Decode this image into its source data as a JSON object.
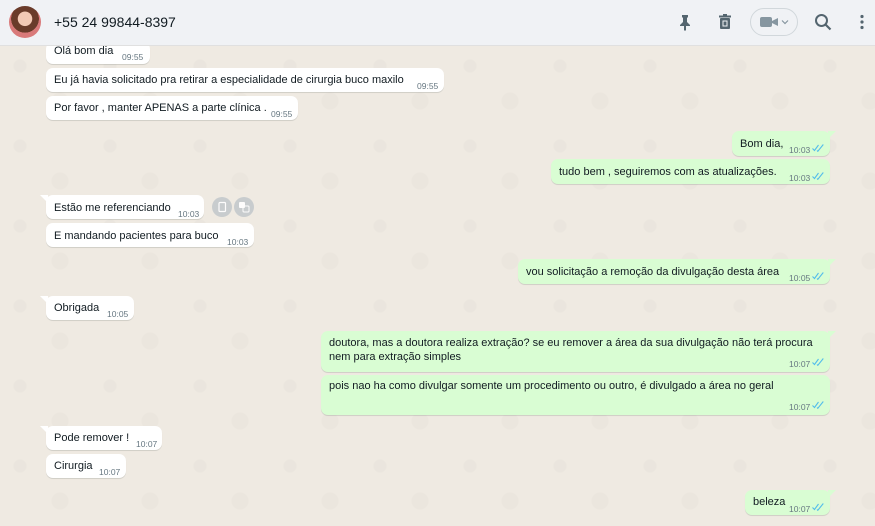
{
  "header": {
    "contact_name": "+55 24 99844-8397",
    "icons": [
      "pin-icon",
      "trash-icon",
      "video-call-icon",
      "chevron-down-icon",
      "search-icon",
      "more-vertical-icon"
    ]
  },
  "colors": {
    "incoming_bubble": "#ffffff",
    "outgoing_bubble": "#d9fdd3",
    "read_ticks": "#53bdeb",
    "chat_background": "#efeae2"
  },
  "messages": [
    {
      "dir": "in",
      "text": "Olá bom dia",
      "time": "09:55"
    },
    {
      "dir": "in",
      "text": "Eu já havia solicitado pra retirar a especialidade de cirurgia buco maxilo",
      "time": "09:55"
    },
    {
      "dir": "in",
      "text": "Por favor , manter APENAS a parte clínica .",
      "time": "09:55"
    },
    {
      "dir": "out",
      "text": "Bom dia,",
      "time": "10:03",
      "status": "read"
    },
    {
      "dir": "out",
      "text": "tudo bem  , seguiremos com as atualizações.",
      "time": "10:03",
      "status": "read"
    },
    {
      "dir": "in",
      "text": "Estão me referenciando",
      "time": "10:03"
    },
    {
      "dir": "in",
      "text": "E mandando pacientes para buco",
      "time": "10:03"
    },
    {
      "dir": "out",
      "text": "vou solicitação a remoção da divulgação desta área",
      "time": "10:05",
      "status": "read"
    },
    {
      "dir": "in",
      "text": "Obrigada",
      "time": "10:05"
    },
    {
      "dir": "out",
      "text": "doutora, mas a doutora realiza extração? se eu remover a área da sua divulgação não terá procura",
      "text2": "nem para extração simples",
      "time": "10:07",
      "status": "read"
    },
    {
      "dir": "out",
      "text": "pois nao ha como divulgar somente um procedimento ou outro, é divulgado a área no geral",
      "time": "10:07",
      "status": "read"
    },
    {
      "dir": "in",
      "text": "Pode remover !",
      "time": "10:07"
    },
    {
      "dir": "in",
      "text": "Cirurgia",
      "time": "10:07"
    },
    {
      "dir": "out",
      "text": "beleza",
      "time": "10:07",
      "status": "read"
    }
  ]
}
